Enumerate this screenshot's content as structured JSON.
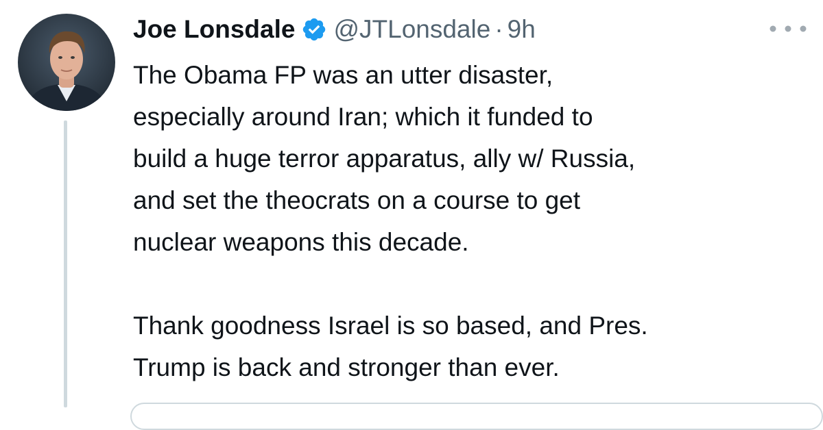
{
  "author": {
    "display_name": "Joe Lonsdale",
    "handle": "@JTLonsdale",
    "separator": "·",
    "time": "9h",
    "verified_icon": "verified-badge-icon"
  },
  "tweet": {
    "paragraphs": [
      "The Obama FP was an utter disaster,\nespecially around Iran; which it funded to\nbuild a huge terror apparatus, ally w/ Russia,\nand set the theocrats on a course to get\nnuclear weapons this decade.",
      "Thank goodness Israel is so based, and Pres.\nTrump is back and stronger than ever."
    ]
  },
  "icons": {
    "more": "more-horizontal-icon",
    "avatar": "profile-photo"
  },
  "colors": {
    "text": "#0f1419",
    "secondary_text": "#536471",
    "verified_blue": "#1d9bf0",
    "thread_line": "#cfd9de"
  }
}
